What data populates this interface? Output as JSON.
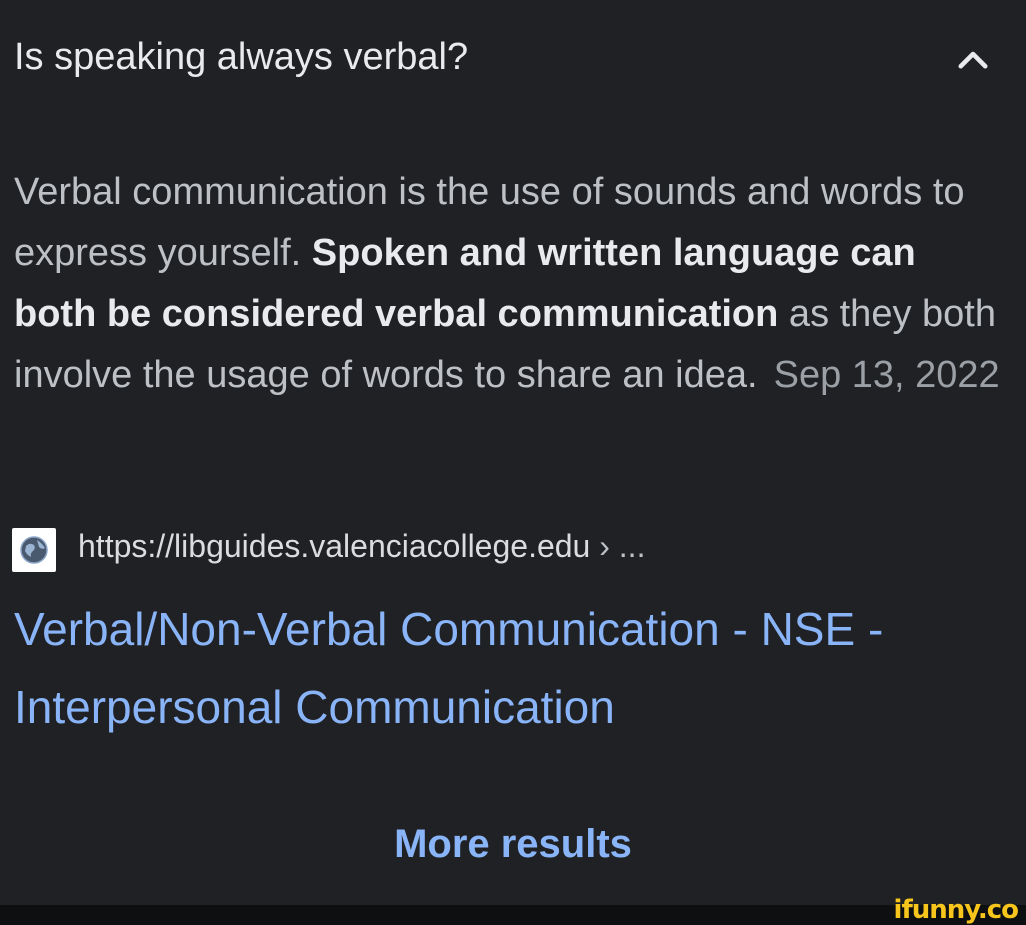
{
  "question": {
    "text": "Is speaking always verbal?",
    "toggle_icon": "chevron-up-icon"
  },
  "answer": {
    "part1": "Verbal communication is the use of sounds and words to express yourself. ",
    "bold": "Spoken and written language can both be considered verbal communication",
    "part2": " as they both involve the usage of words to share an idea.",
    "date": "Sep 13, 2022"
  },
  "source": {
    "favicon": "globe-icon",
    "url": "https://libguides.valenciacollege.edu",
    "crumb": " › ..."
  },
  "result": {
    "title": "Verbal/Non-Verbal Communication - NSE - Interpersonal Communication"
  },
  "more_results": {
    "label": "More results"
  },
  "watermark": {
    "text": "ifunny.co"
  },
  "colors": {
    "background": "#202124",
    "link": "#8ab4f8",
    "text": "#bdc1c6",
    "watermark": "#f8c51c"
  }
}
